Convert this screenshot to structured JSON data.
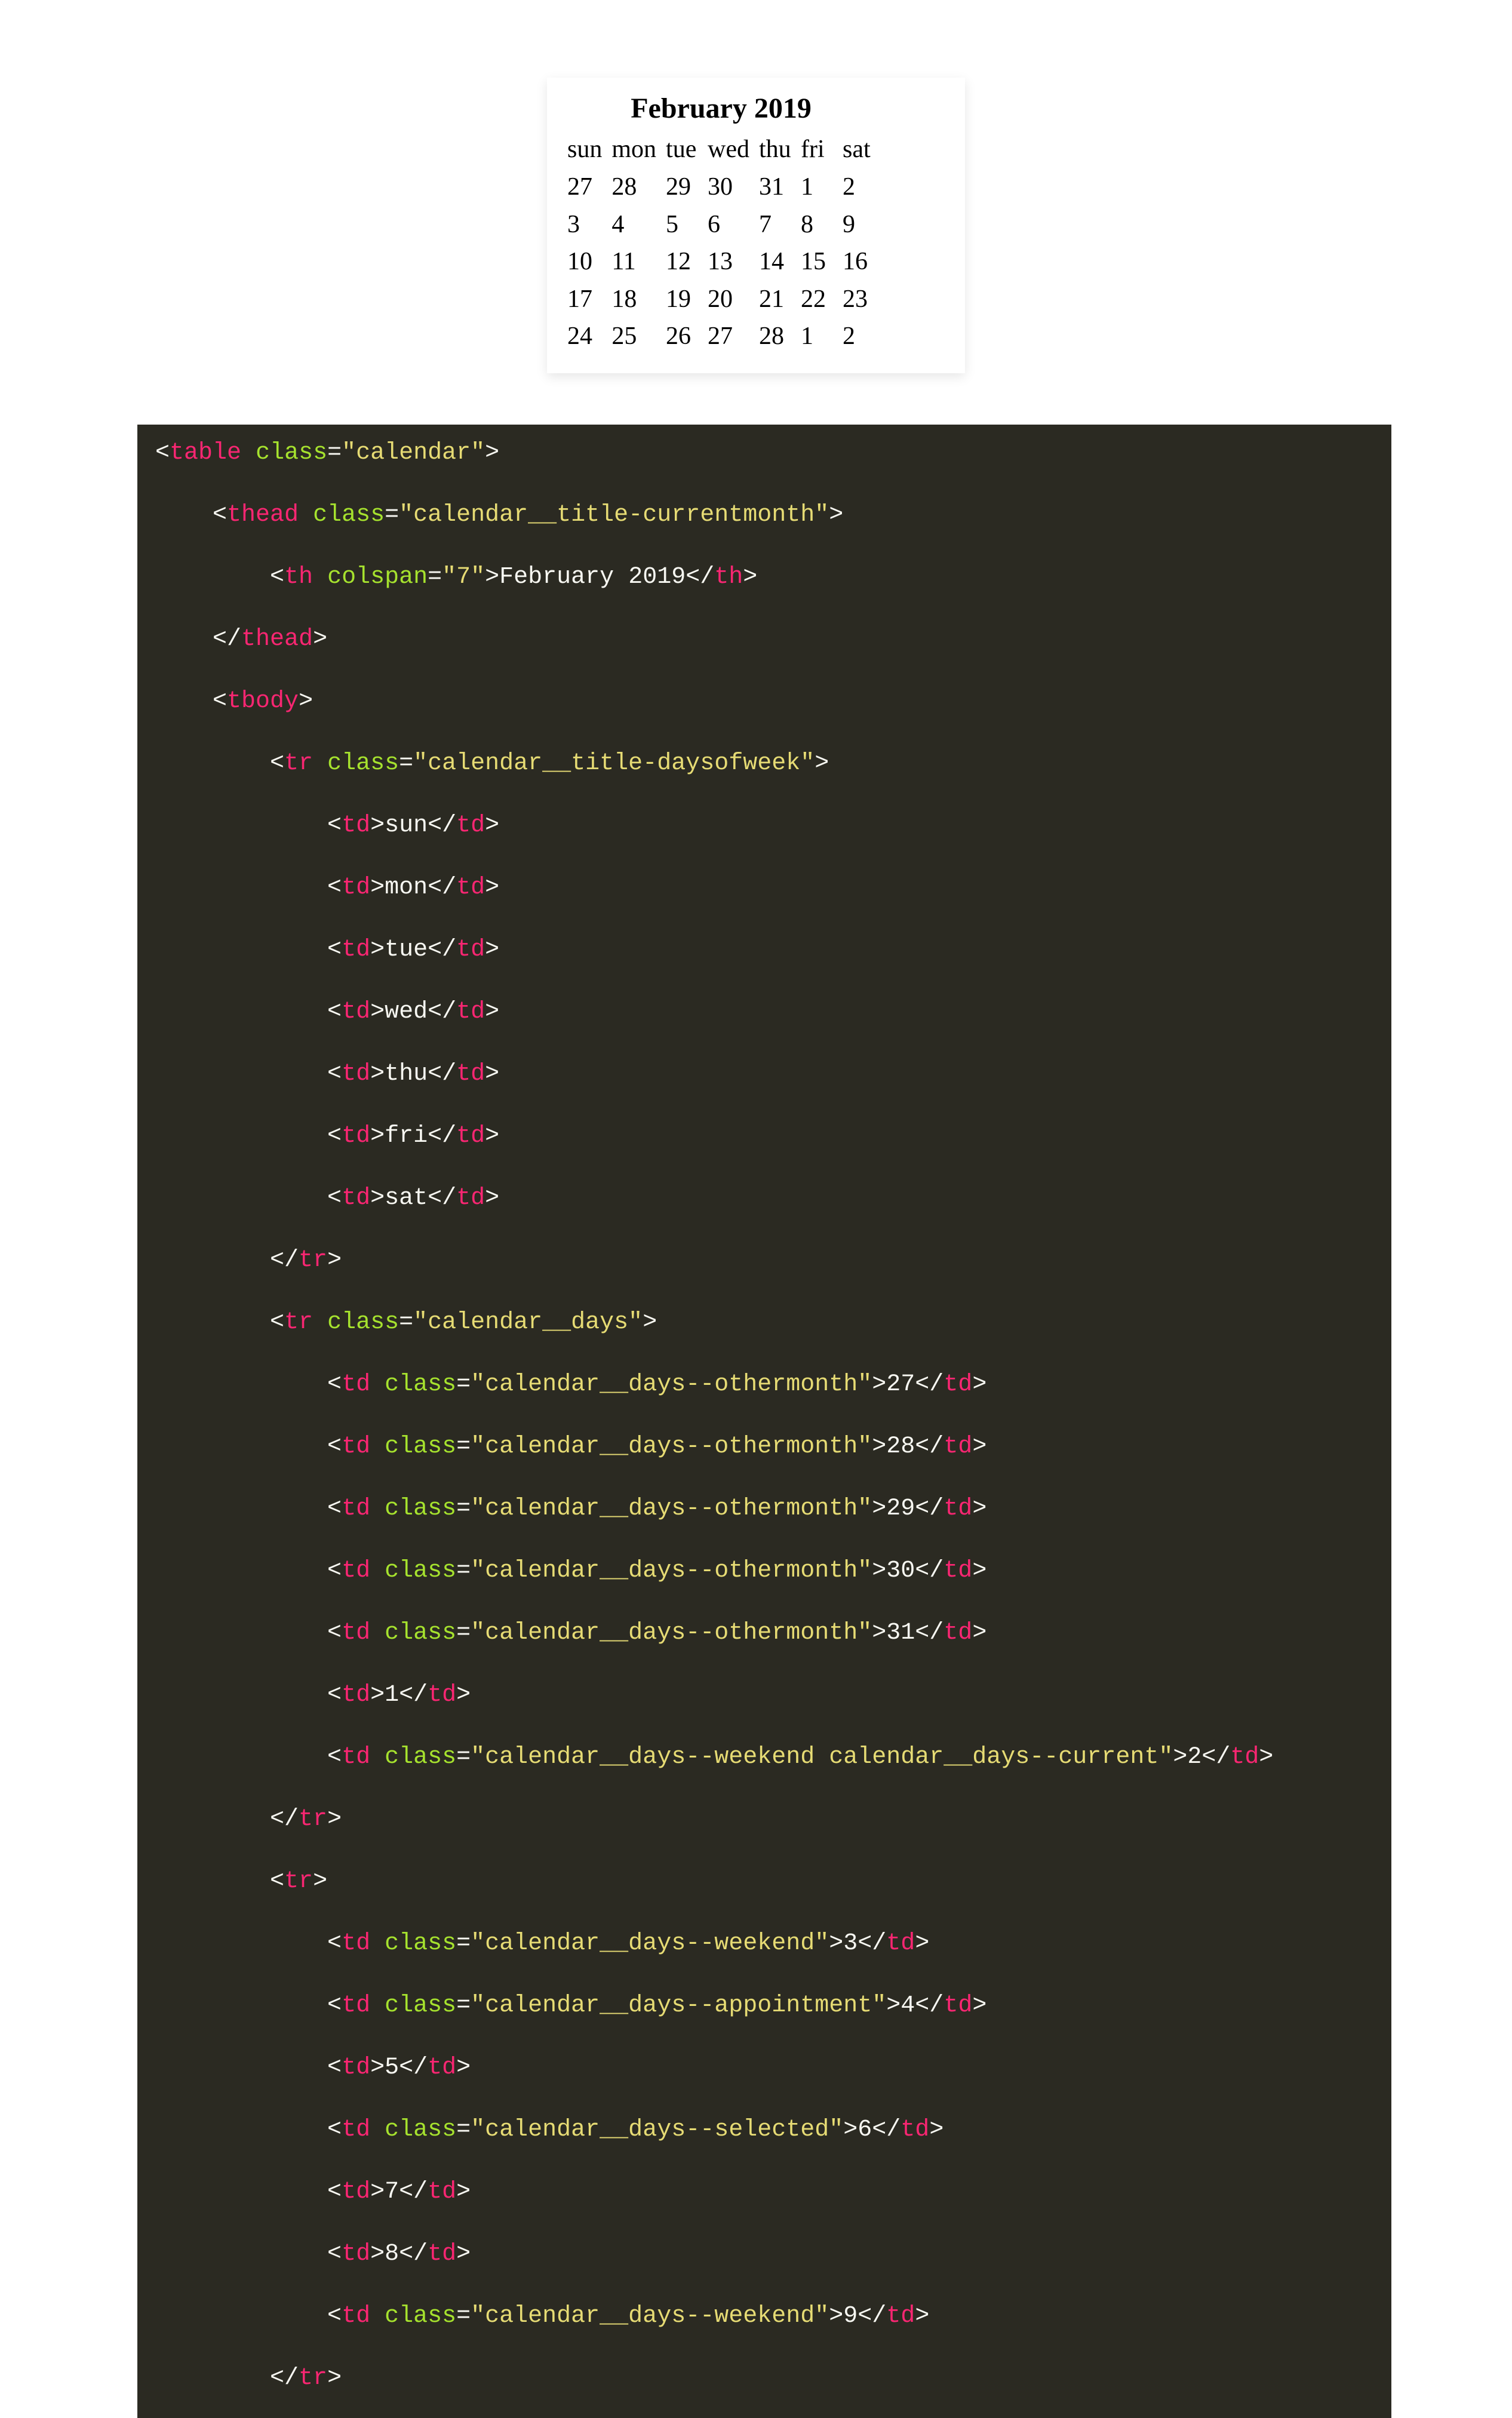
{
  "calendar": {
    "title": "February 2019",
    "dow": [
      "sun",
      "mon",
      "tue",
      "wed",
      "thu",
      "fri",
      "sat"
    ],
    "rows": [
      [
        "27",
        "28",
        "29",
        "30",
        "31",
        "1",
        "2"
      ],
      [
        "3",
        "4",
        "5",
        "6",
        "7",
        "8",
        "9"
      ],
      [
        "10",
        "11",
        "12",
        "13",
        "14",
        "15",
        "16"
      ],
      [
        "17",
        "18",
        "19",
        "20",
        "21",
        "22",
        "23"
      ],
      [
        "24",
        "25",
        "26",
        "27",
        "28",
        "1",
        "2"
      ]
    ]
  },
  "code": {
    "indent": "    ",
    "lines": [
      {
        "d": 0,
        "k": "open",
        "tag": "table",
        "attrs": [
          [
            "class",
            "calendar"
          ]
        ]
      },
      {
        "d": 1,
        "k": "open",
        "tag": "thead",
        "attrs": [
          [
            "class",
            "calendar__title-currentmonth"
          ]
        ]
      },
      {
        "d": 2,
        "k": "leaf",
        "tag": "th",
        "attrs": [
          [
            "colspan",
            "7"
          ]
        ],
        "text": "February 2019"
      },
      {
        "d": 1,
        "k": "close",
        "tag": "thead"
      },
      {
        "d": 1,
        "k": "open",
        "tag": "tbody"
      },
      {
        "d": 2,
        "k": "open",
        "tag": "tr",
        "attrs": [
          [
            "class",
            "calendar__title-daysofweek"
          ]
        ]
      },
      {
        "d": 3,
        "k": "leaf",
        "tag": "td",
        "text": "sun"
      },
      {
        "d": 3,
        "k": "leaf",
        "tag": "td",
        "text": "mon"
      },
      {
        "d": 3,
        "k": "leaf",
        "tag": "td",
        "text": "tue"
      },
      {
        "d": 3,
        "k": "leaf",
        "tag": "td",
        "text": "wed"
      },
      {
        "d": 3,
        "k": "leaf",
        "tag": "td",
        "text": "thu"
      },
      {
        "d": 3,
        "k": "leaf",
        "tag": "td",
        "text": "fri"
      },
      {
        "d": 3,
        "k": "leaf",
        "tag": "td",
        "text": "sat"
      },
      {
        "d": 2,
        "k": "close",
        "tag": "tr"
      },
      {
        "d": 2,
        "k": "open",
        "tag": "tr",
        "attrs": [
          [
            "class",
            "calendar__days"
          ]
        ]
      },
      {
        "d": 3,
        "k": "leaf",
        "tag": "td",
        "attrs": [
          [
            "class",
            "calendar__days--othermonth"
          ]
        ],
        "text": "27"
      },
      {
        "d": 3,
        "k": "leaf",
        "tag": "td",
        "attrs": [
          [
            "class",
            "calendar__days--othermonth"
          ]
        ],
        "text": "28"
      },
      {
        "d": 3,
        "k": "leaf",
        "tag": "td",
        "attrs": [
          [
            "class",
            "calendar__days--othermonth"
          ]
        ],
        "text": "29"
      },
      {
        "d": 3,
        "k": "leaf",
        "tag": "td",
        "attrs": [
          [
            "class",
            "calendar__days--othermonth"
          ]
        ],
        "text": "30"
      },
      {
        "d": 3,
        "k": "leaf",
        "tag": "td",
        "attrs": [
          [
            "class",
            "calendar__days--othermonth"
          ]
        ],
        "text": "31"
      },
      {
        "d": 3,
        "k": "leaf",
        "tag": "td",
        "text": "1"
      },
      {
        "d": 3,
        "k": "leaf",
        "tag": "td",
        "attrs": [
          [
            "class",
            "calendar__days--weekend calendar__days--current"
          ]
        ],
        "text": "2"
      },
      {
        "d": 2,
        "k": "close",
        "tag": "tr"
      },
      {
        "d": 2,
        "k": "open",
        "tag": "tr"
      },
      {
        "d": 3,
        "k": "leaf",
        "tag": "td",
        "attrs": [
          [
            "class",
            "calendar__days--weekend"
          ]
        ],
        "text": "3"
      },
      {
        "d": 3,
        "k": "leaf",
        "tag": "td",
        "attrs": [
          [
            "class",
            "calendar__days--appointment"
          ]
        ],
        "text": "4"
      },
      {
        "d": 3,
        "k": "leaf",
        "tag": "td",
        "text": "5"
      },
      {
        "d": 3,
        "k": "leaf",
        "tag": "td",
        "attrs": [
          [
            "class",
            "calendar__days--selected"
          ]
        ],
        "text": "6"
      },
      {
        "d": 3,
        "k": "leaf",
        "tag": "td",
        "text": "7"
      },
      {
        "d": 3,
        "k": "leaf",
        "tag": "td",
        "text": "8"
      },
      {
        "d": 3,
        "k": "leaf",
        "tag": "td",
        "attrs": [
          [
            "class",
            "calendar__days--weekend"
          ]
        ],
        "text": "9"
      },
      {
        "d": 2,
        "k": "close",
        "tag": "tr"
      }
    ]
  }
}
